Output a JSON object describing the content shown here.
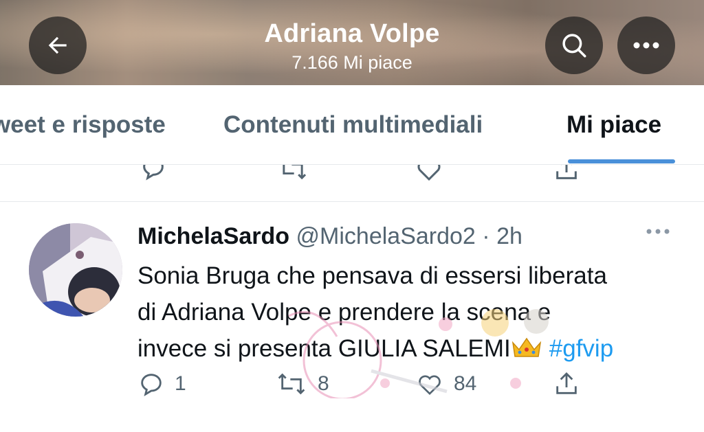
{
  "header": {
    "title": "Adriana Volpe",
    "subtitle": "7.166 Mi piace",
    "back_icon": "arrow-left-icon",
    "search_icon": "search-icon",
    "more_icon": "more-horizontal-icon"
  },
  "tabs": [
    {
      "label": "Tweet e risposte",
      "visible_label": "weet e risposte",
      "selected": false
    },
    {
      "label": "Contenuti multimediali",
      "selected": false
    },
    {
      "label": "Mi piace",
      "selected": true
    }
  ],
  "tweet": {
    "author": "MichelaSardo",
    "handle": "@MichelaSardo2",
    "separator": "·",
    "time": "2h",
    "text_lines": [
      "Sonia Bruga che pensava di essersi liberata",
      "di Adriana Volpe e prendere la scena e",
      "invece si presenta GIULIA SALEMI"
    ],
    "hashtag": "#gfvip",
    "actions": {
      "reply_count": "1",
      "retweet_count": "8",
      "like_count": "84"
    }
  },
  "colors": {
    "accent": "#1d9bf0",
    "tab_underline": "#4a90d9",
    "secondary_text": "#536471"
  }
}
